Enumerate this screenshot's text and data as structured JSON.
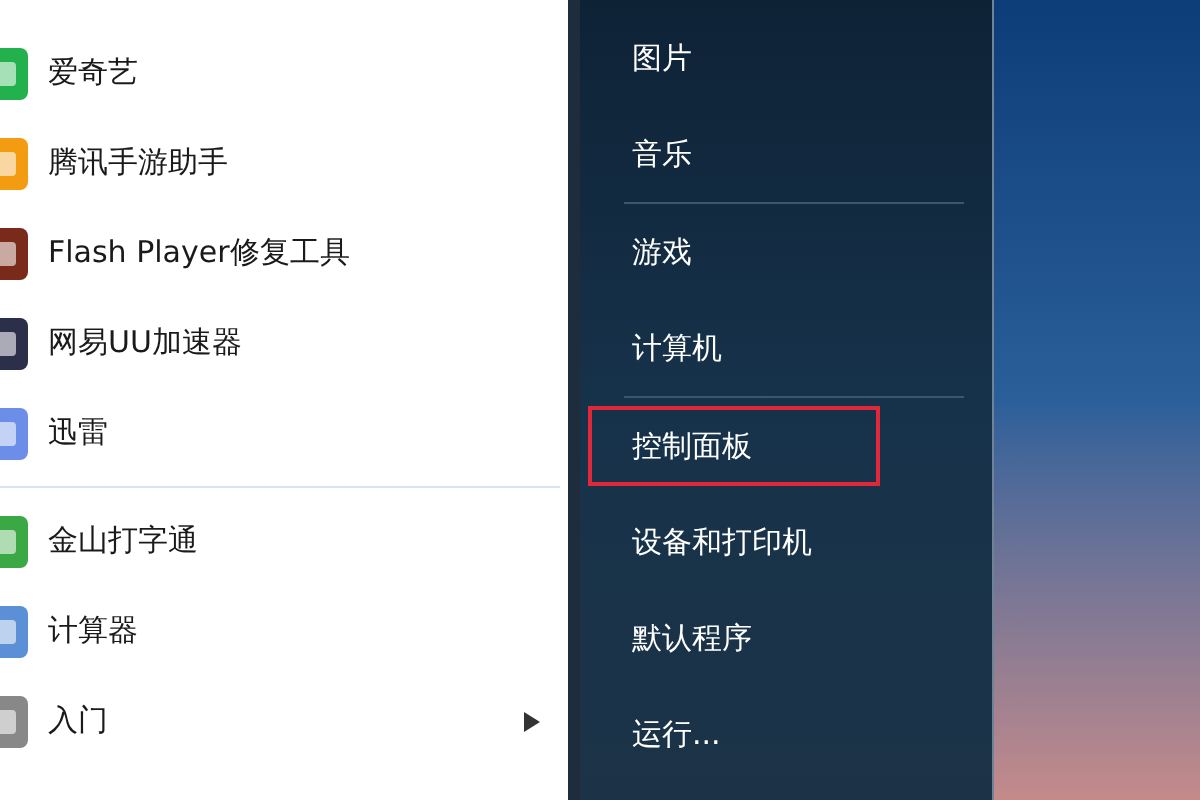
{
  "programs": {
    "groups": [
      [
        {
          "label": "爱奇艺",
          "kind": "app"
        },
        {
          "label": "腾讯手游助手",
          "kind": "app"
        },
        {
          "label": "Flash Player修复工具",
          "kind": "app"
        },
        {
          "label": "网易UU加速器",
          "kind": "app"
        },
        {
          "label": "迅雷",
          "kind": "app"
        }
      ],
      [
        {
          "label": "金山打字通",
          "kind": "app"
        },
        {
          "label": "计算器",
          "kind": "app"
        },
        {
          "label": "入门",
          "kind": "submenu"
        }
      ]
    ]
  },
  "places": {
    "groups": [
      [
        {
          "label": "图片",
          "highlighted": false
        },
        {
          "label": "音乐",
          "highlighted": false
        }
      ],
      [
        {
          "label": "游戏",
          "highlighted": false
        },
        {
          "label": "计算机",
          "highlighted": false
        }
      ],
      [
        {
          "label": "控制面板",
          "highlighted": true
        },
        {
          "label": "设备和打印机",
          "highlighted": false
        },
        {
          "label": "默认程序",
          "highlighted": false
        },
        {
          "label": "运行...",
          "highlighted": false
        }
      ]
    ]
  }
}
